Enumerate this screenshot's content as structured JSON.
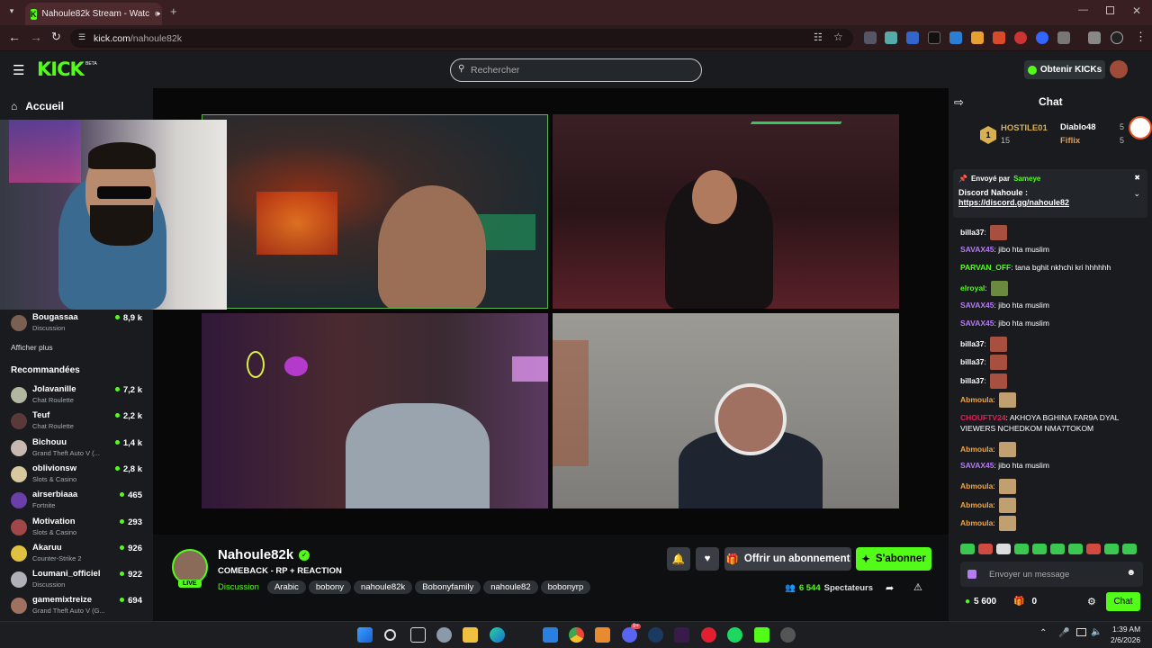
{
  "browser": {
    "tab_title": "Nahoule82k Stream - Watc",
    "url_domain": "kick.com",
    "url_path": "/nahoule82k"
  },
  "header": {
    "logo": "KICK",
    "beta": "BETA",
    "search_placeholder": "Rechercher",
    "kicks_button": "Obtenir KICKs"
  },
  "sidebar": {
    "home": "Accueil",
    "following": [
      {
        "name": "Bougassaa",
        "category": "Discussion",
        "viewers": "8,9 k",
        "color": "#7a6050"
      }
    ],
    "show_more": "Afficher plus",
    "recommended_title": "Recommandées",
    "recommended": [
      {
        "name": "Jolavanille",
        "category": "Chat Roulette",
        "viewers": "7,2 k",
        "color": "#b0b8a0"
      },
      {
        "name": "Teuf",
        "category": "Chat Roulette",
        "viewers": "2,2 k",
        "color": "#5a3a38"
      },
      {
        "name": "Bichouu",
        "category": "Grand Theft Auto V (...",
        "viewers": "1,4 k",
        "color": "#c8b8b0"
      },
      {
        "name": "oblivionsw",
        "category": "Slots & Casino",
        "viewers": "2,8 k",
        "color": "#d8c8a0"
      },
      {
        "name": "airserbiaaa",
        "category": "Fortnite",
        "viewers": "465",
        "color": "#6a40a8"
      },
      {
        "name": "Motivation",
        "category": "Slots & Casino",
        "viewers": "293",
        "color": "#a04848"
      },
      {
        "name": "Akaruu",
        "category": "Counter-Strike 2",
        "viewers": "926",
        "color": "#e0c040"
      },
      {
        "name": "Loumani_officiel",
        "category": "Discussion",
        "viewers": "922",
        "color": "#b0b0b8"
      },
      {
        "name": "gamemixtreize",
        "category": "Grand Theft Auto V (G...",
        "viewers": "694",
        "color": "#a07060"
      }
    ]
  },
  "stream": {
    "live_badge": "LIVE",
    "streamer": "Nahoule82k",
    "title": "COMEBACK - RP + REACTION",
    "category": "Discussion",
    "tags": [
      "Arabic",
      "bobony",
      "nahoule82k",
      "Bobonyfamily",
      "nahoule82",
      "bobonyrp"
    ],
    "gift_sub": "Offrir un abonnement",
    "subscribe": "S'abonner",
    "viewers_count": "6 544",
    "viewers_label": "Spectateurs"
  },
  "chat": {
    "title": "Chat",
    "leaderboard": [
      {
        "rank": "1",
        "name": "HOSTILE01",
        "count": "15",
        "color": "#d8b050"
      },
      {
        "name": "Diablo48",
        "count": "5",
        "color": "#ffffff"
      },
      {
        "name": "Fiflix",
        "count": "5",
        "color": "#d8a060"
      }
    ],
    "pinned": {
      "sent_by_label": "Envoyé par",
      "sender": "Sameye",
      "title": "Discord Nahoule :",
      "link": "https://discord.gg/nahoule82"
    },
    "messages": [
      {
        "user": "billa37",
        "text": "",
        "emote": true,
        "color": "#ffffff"
      },
      {
        "user": "SAVAX45",
        "text": "jibo hta muslim",
        "emote": false,
        "color": "#b57cf2"
      },
      {
        "user": "PARVAN_OFF",
        "text": "tana bghit nkhchi kri hhhhhh",
        "emote": false,
        "color": "#53fc18"
      },
      {
        "user": "elroyal",
        "text": "",
        "emote": true,
        "color": "#53fc18"
      },
      {
        "user": "SAVAX45",
        "text": "jibo hta muslim",
        "emote": false,
        "color": "#b57cf2"
      },
      {
        "user": "SAVAX45",
        "text": "jibo hta muslim",
        "emote": false,
        "color": "#b57cf2"
      },
      {
        "user": "billa37",
        "text": "",
        "emote": true,
        "color": "#ffffff"
      },
      {
        "user": "billa37",
        "text": "",
        "emote": true,
        "color": "#ffffff"
      },
      {
        "user": "billa37",
        "text": "",
        "emote": true,
        "color": "#ffffff"
      },
      {
        "user": "Abmoula",
        "text": "",
        "emote": true,
        "color": "#f2a541"
      },
      {
        "user": "CHOUFTV24",
        "text": "AKHOYA BGHINA FAR9A DYAL VIEWERS NCHEDKOM NMA7TOKOM",
        "emote": false,
        "color": "#e0215a"
      },
      {
        "user": "Abmoula",
        "text": "",
        "emote": true,
        "color": "#f2a541"
      },
      {
        "user": "SAVAX45",
        "text": "jibo hta muslim",
        "emote": false,
        "color": "#b57cf2"
      },
      {
        "user": "Abmoula",
        "text": "",
        "emote": true,
        "color": "#f2a541"
      },
      {
        "user": "Abmoula",
        "text": "",
        "emote": true,
        "color": "#f2a541"
      },
      {
        "user": "Abmoula",
        "text": "",
        "emote": true,
        "color": "#f2a541"
      }
    ],
    "input_placeholder": "Envoyer un message",
    "points": "5 600",
    "gifts": "0",
    "send_button": "Chat"
  },
  "taskbar": {
    "time": "1:39 AM",
    "date": "2/6/2026",
    "discord_badge": "9+"
  },
  "colors": {
    "kick_green": "#53fc18",
    "panel": "#191b1f",
    "browser_tab": "#3a1f22"
  }
}
